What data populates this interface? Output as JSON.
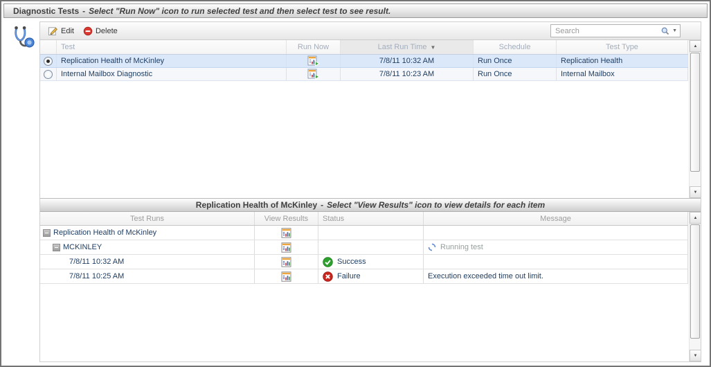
{
  "window": {
    "title": "Diagnostic Tests",
    "title_separator": "-",
    "title_hint": "Select \"Run Now\" icon to run selected test and then select test to see result."
  },
  "toolbar": {
    "edit": "Edit",
    "delete": "Delete",
    "search_placeholder": "Search"
  },
  "tests_grid": {
    "columns": {
      "test": "Test",
      "run_now": "Run Now",
      "last_run_time": "Last Run Time",
      "schedule": "Schedule",
      "test_type": "Test Type"
    },
    "sort": {
      "column": "Last Run Time",
      "direction": "descending",
      "indicator": "▼"
    },
    "rows": [
      {
        "selected": true,
        "test": "Replication Health of McKinley",
        "last_run_time": "7/8/11 10:32 AM",
        "schedule": "Run Once",
        "test_type": "Replication Health"
      },
      {
        "selected": false,
        "test": "Internal Mailbox Diagnostic",
        "last_run_time": "7/8/11 10:23 AM",
        "schedule": "Run Once",
        "test_type": "Internal Mailbox"
      }
    ]
  },
  "results_section": {
    "title": "Replication Health of McKinley",
    "title_separator": "-",
    "title_hint": "Select \"View Results\" icon to view details for each item"
  },
  "results_grid": {
    "columns": {
      "test_runs": "Test Runs",
      "view_results": "View Results",
      "status": "Status",
      "message": "Message"
    },
    "rows": [
      {
        "label": "Replication Health of McKinley",
        "level": 0,
        "expanded": true,
        "status": "",
        "message": ""
      },
      {
        "label": "MCKINLEY",
        "level": 1,
        "expanded": true,
        "status": "",
        "message": "Running test"
      },
      {
        "label": "7/8/11 10:32 AM",
        "level": 2,
        "expanded": false,
        "status": "Success",
        "message": ""
      },
      {
        "label": "7/8/11 10:25 AM",
        "level": 2,
        "expanded": false,
        "status": "Failure",
        "message": "Execution exceeded time out limit."
      }
    ]
  },
  "icons": {
    "app": "stethoscope-icon",
    "edit": "pencil-icon",
    "delete": "minus-circle-icon",
    "search": "magnifier-icon",
    "search_dropdown": "chevron-down-icon",
    "run_now": "report-run-icon",
    "view_results": "report-chart-icon",
    "collapse": "minus-box-icon",
    "running": "spinner-icon",
    "success": "check-circle-icon",
    "failure": "x-circle-icon",
    "sort_descending": "triangle-down-icon"
  },
  "colors": {
    "selection_bg": "#dbe8fa",
    "success_green": "#2da12d",
    "failure_red": "#c8261f",
    "spinner_blue": "#6a8fd8",
    "run_arrow_green": "#4aa84a",
    "header_text_gray": "#a3adbb",
    "cell_text_navy": "#1f3e63"
  }
}
